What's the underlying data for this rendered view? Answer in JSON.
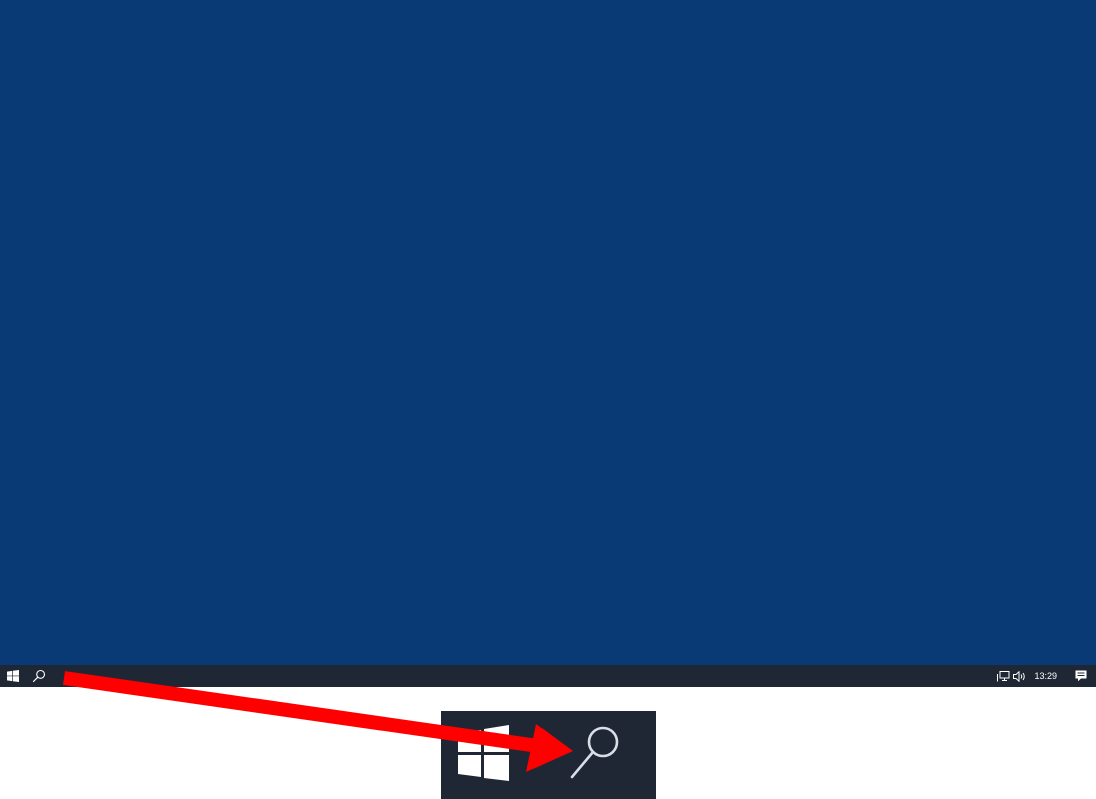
{
  "desktop": {
    "background_color": "#0a3a75"
  },
  "taskbar": {
    "background_color": "#1f2734",
    "start_icon": "windows-logo-icon",
    "search_icon": "search-icon",
    "tray": {
      "network_icon": "network-icon",
      "volume_icon": "volume-icon",
      "clock_time": "13:29",
      "notifications_icon": "action-center-icon"
    }
  },
  "zoom_callout": {
    "start_icon": "windows-logo-icon",
    "search_icon": "search-icon"
  },
  "annotation": {
    "arrow_color": "#ff0000"
  }
}
